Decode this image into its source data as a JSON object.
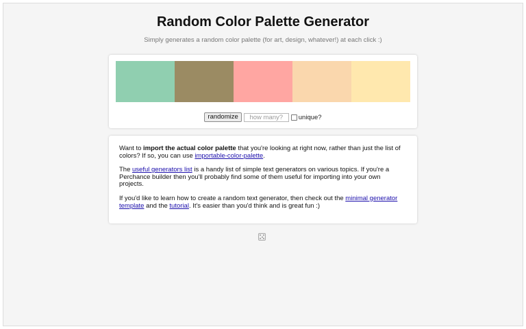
{
  "page": {
    "title": "Random Color Palette Generator",
    "subtitle": "Simply generates a random color palette (for art, design, whatever!) at each click :)"
  },
  "palette": {
    "swatches": [
      {
        "color": "#90cfb0"
      },
      {
        "color": "#9b8b63"
      },
      {
        "color": "#ffa6a2"
      },
      {
        "color": "#fad7ad"
      },
      {
        "color": "#ffe8ae"
      }
    ]
  },
  "controls": {
    "randomize_label": "randomize",
    "count_placeholder": "how many?",
    "unique_label": "unique?",
    "unique_checked": false
  },
  "info": {
    "p1": {
      "pre": "Want to ",
      "bold": "import the actual color palette",
      "mid": " that you're looking at right now, rather than just the list of colors? If so, you can use ",
      "link": "importable-color-palette",
      "post": "."
    },
    "p2": {
      "pre": "The ",
      "link": "useful generators list",
      "post": " is a handy list of simple text generators on various topics. If you're a Perchance builder then you'll probably find some of them useful for importing into your own projects."
    },
    "p3": {
      "pre": "If you'd like to learn how to create a random text generator, then check out the ",
      "link1": "minimal generator template",
      "mid": " and the ",
      "link2": "tutorial",
      "post": ". It's easier than you'd think and is great fun :)"
    }
  },
  "footer": {
    "icon": "dice-icon"
  }
}
